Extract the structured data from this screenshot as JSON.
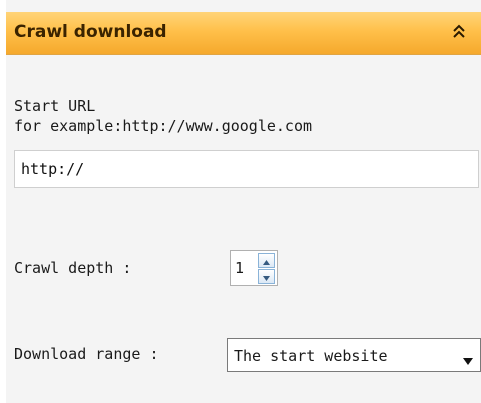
{
  "panel": {
    "title": "Crawl download",
    "collapse_icon": "double-chevron-up-icon"
  },
  "start_url": {
    "label": "Start URL",
    "hint": "for example:http://www.google.com",
    "value": "http://"
  },
  "crawl_depth": {
    "label": "Crawl depth :",
    "value": "1",
    "up_icon": "spin-up-icon",
    "down_icon": "spin-down-icon"
  },
  "download_range": {
    "label": "Download range :",
    "selected": "The start website",
    "arrow_icon": "chevron-down-icon"
  },
  "colors": {
    "header_top": "#ffd478",
    "header_bottom": "#f5a92c",
    "panel_bg": "#f4f4f4"
  }
}
